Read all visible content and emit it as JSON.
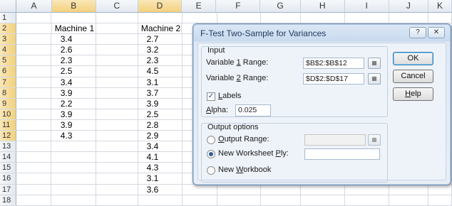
{
  "columns": [
    "A",
    "B",
    "C",
    "D",
    "E",
    "F",
    "G",
    "H",
    "I",
    "J",
    "K"
  ],
  "selected_columns": [
    "B",
    "D"
  ],
  "rows": [
    {
      "n": "1",
      "b": "",
      "d": ""
    },
    {
      "n": "2",
      "b": "Machine 1",
      "d": "Machine 2"
    },
    {
      "n": "3",
      "b": "3.4",
      "d": "2.7"
    },
    {
      "n": "4",
      "b": "2.6",
      "d": "3.2"
    },
    {
      "n": "5",
      "b": "2.3",
      "d": "2.3"
    },
    {
      "n": "6",
      "b": "2.5",
      "d": "4.5"
    },
    {
      "n": "7",
      "b": "3.4",
      "d": "3.1"
    },
    {
      "n": "8",
      "b": "3.9",
      "d": "3.7"
    },
    {
      "n": "9",
      "b": "2.2",
      "d": "3.9"
    },
    {
      "n": "10",
      "b": "3.9",
      "d": "2.5"
    },
    {
      "n": "11",
      "b": "3.9",
      "d": "2.8"
    },
    {
      "n": "12",
      "b": "4.3",
      "d": "2.9"
    },
    {
      "n": "13",
      "b": "",
      "d": "3.4"
    },
    {
      "n": "14",
      "b": "",
      "d": "4.1"
    },
    {
      "n": "15",
      "b": "",
      "d": "4.3"
    },
    {
      "n": "16",
      "b": "",
      "d": "3.1"
    },
    {
      "n": "17",
      "b": "",
      "d": "3.6"
    },
    {
      "n": "18",
      "b": "",
      "d": ""
    }
  ],
  "dialog": {
    "title": "F-Test Two-Sample for Variances",
    "help_icon": "?",
    "close_icon": "✕",
    "input_group": "Input",
    "var1_label_pre": "Variable ",
    "var1_label_key": "1",
    "var1_label_post": " Range:",
    "var1_value": "$B$2:$B$12",
    "var2_label_pre": "Variable ",
    "var2_label_key": "2",
    "var2_label_post": " Range:",
    "var2_value": "$D$2:$D$17",
    "labels_key": "L",
    "labels_rest": "abels",
    "labels_checked": true,
    "alpha_key": "A",
    "alpha_rest": "lpha:",
    "alpha_value": "0.025",
    "output_group": "Output options",
    "output_range_key": "O",
    "output_range_rest": "utput Range:",
    "output_range_value": "",
    "new_ws_pre": "New Worksheet ",
    "new_ws_key": "P",
    "new_ws_rest": "ly:",
    "new_ws_value": "",
    "new_wb_pre": "New ",
    "new_wb_key": "W",
    "new_wb_rest": "orkbook",
    "selected_output": "new_worksheet",
    "ok_label": "OK",
    "cancel_label": "Cancel",
    "help_key": "H",
    "help_rest": "elp"
  }
}
